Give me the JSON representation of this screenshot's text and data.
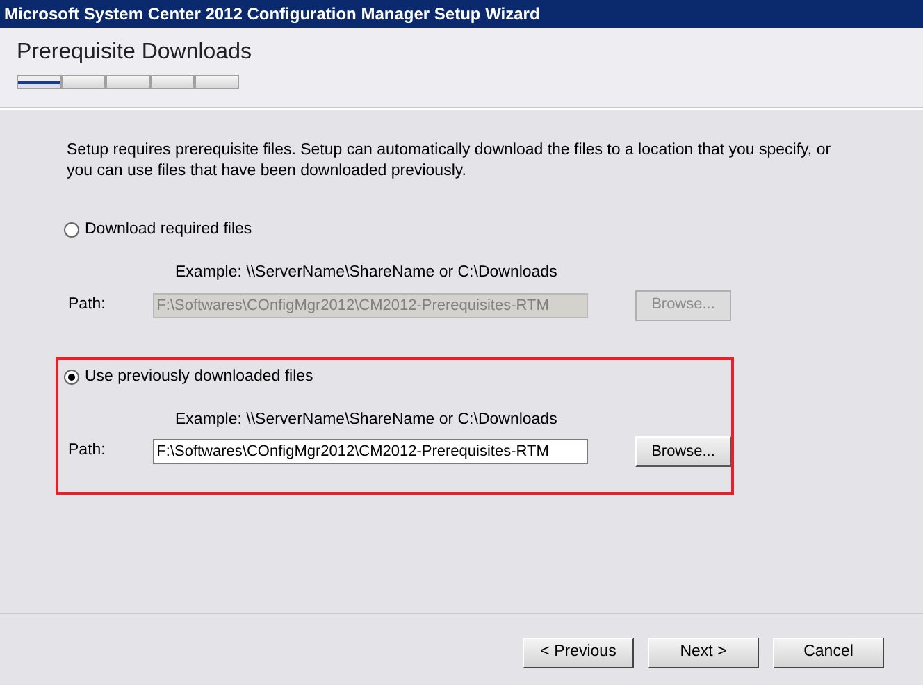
{
  "window": {
    "title": "Microsoft System Center 2012 Configuration Manager Setup Wizard"
  },
  "header": {
    "title": "Prerequisite Downloads",
    "steps": [
      {
        "selected": true
      },
      {
        "selected": false
      },
      {
        "selected": false
      },
      {
        "selected": false
      },
      {
        "selected": false
      }
    ]
  },
  "description": "Setup requires prerequisite files. Setup can automatically download the files to a location that you specify, or you can use files that have been downloaded previously.",
  "options": [
    {
      "label": "Download required files",
      "selected": false,
      "highlighted": false,
      "example": "Example: \\\\ServerName\\ShareName or C:\\Downloads",
      "path_label": "Path:",
      "path": "F:\\Softwares\\COnfigMgr2012\\CM2012-Prerequisites-RTM",
      "disabled": true,
      "browse": "Browse..."
    },
    {
      "label": "Use previously downloaded files",
      "selected": true,
      "highlighted": true,
      "example": "Example: \\\\ServerName\\ShareName or C:\\Downloads",
      "path_label": "Path:",
      "path": "F:\\Softwares\\COnfigMgr2012\\CM2012-Prerequisites-RTM",
      "disabled": false,
      "browse": "Browse..."
    }
  ],
  "buttons": [
    "< Previous",
    "Next >",
    "Cancel"
  ]
}
